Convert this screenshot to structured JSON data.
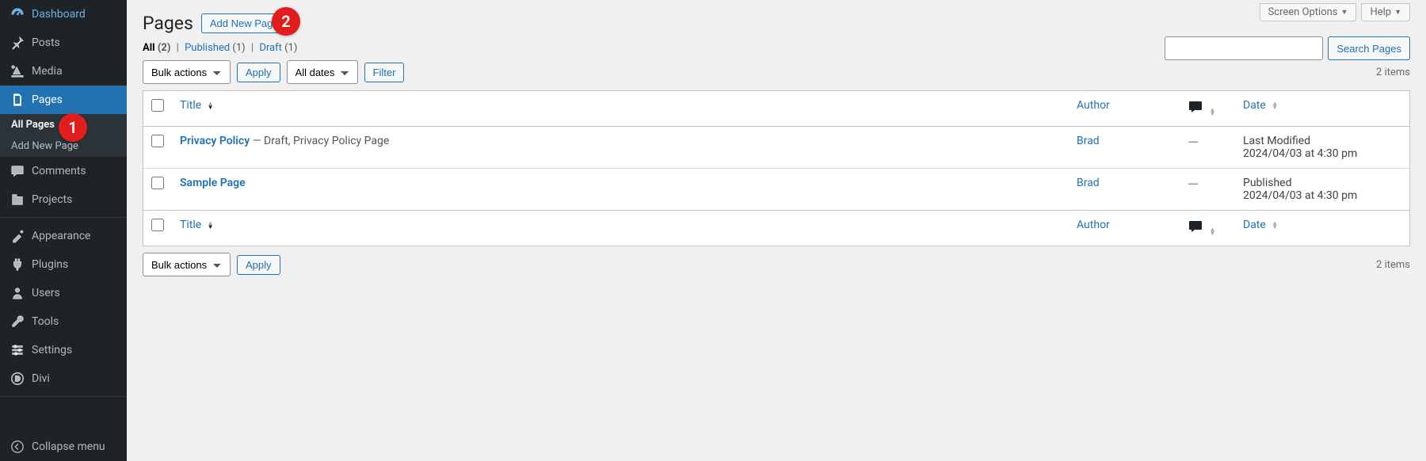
{
  "sidebar": {
    "items": [
      {
        "icon": "dashboard",
        "label": "Dashboard"
      },
      {
        "icon": "pin",
        "label": "Posts"
      },
      {
        "icon": "media",
        "label": "Media"
      },
      {
        "icon": "page",
        "label": "Pages",
        "current": true,
        "submenu": [
          {
            "label": "All Pages",
            "active": true
          },
          {
            "label": "Add New Page"
          }
        ]
      },
      {
        "icon": "comment",
        "label": "Comments"
      },
      {
        "icon": "projects",
        "label": "Projects"
      },
      {
        "icon": "appearance",
        "label": "Appearance"
      },
      {
        "icon": "plugin",
        "label": "Plugins"
      },
      {
        "icon": "user",
        "label": "Users"
      },
      {
        "icon": "tools",
        "label": "Tools"
      },
      {
        "icon": "settings",
        "label": "Settings"
      },
      {
        "icon": "divi",
        "label": "Divi"
      }
    ],
    "collapse": "Collapse menu"
  },
  "badges": {
    "one": "1",
    "two": "2"
  },
  "top": {
    "screen_options": "Screen Options",
    "help": "Help"
  },
  "heading": {
    "title": "Pages",
    "add_new": "Add New Page"
  },
  "status": {
    "all_label": "All",
    "all_count": "(2)",
    "published_label": "Published",
    "published_count": "(1)",
    "draft_label": "Draft",
    "draft_count": "(1)",
    "sep": " | "
  },
  "search": {
    "button": "Search Pages"
  },
  "nav": {
    "bulk": "Bulk actions",
    "apply": "Apply",
    "dates": "All dates",
    "filter": "Filter",
    "items": "2 items"
  },
  "cols": {
    "title": "Title",
    "author": "Author",
    "date": "Date"
  },
  "rows": [
    {
      "title": "Privacy Policy",
      "meta": " — Draft, Privacy Policy Page",
      "author": "Brad",
      "comments": "—",
      "date_status": "Last Modified",
      "date_time": "2024/04/03 at 4:30 pm"
    },
    {
      "title": "Sample Page",
      "meta": "",
      "author": "Brad",
      "comments": "—",
      "date_status": "Published",
      "date_time": "2024/04/03 at 4:30 pm"
    }
  ]
}
